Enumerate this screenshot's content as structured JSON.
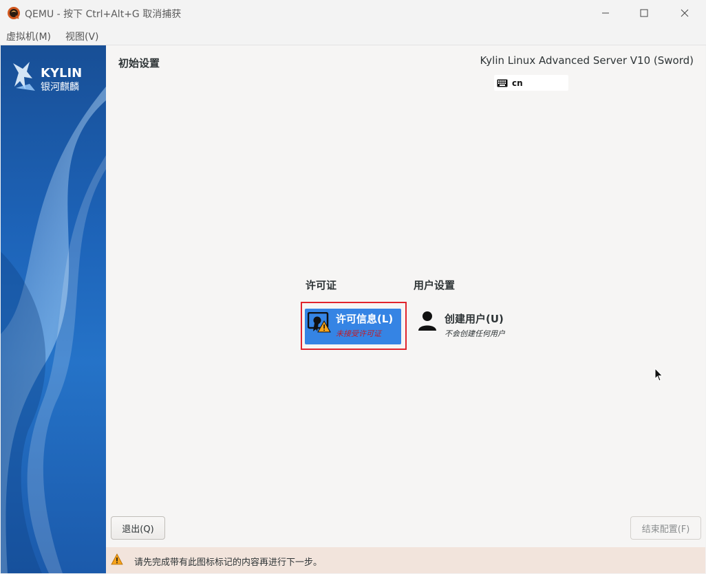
{
  "window": {
    "title": "QEMU - 按下 Ctrl+Alt+G 取消捕获",
    "app_icon": "qemu-logo-icon",
    "controls": [
      "minimize-icon",
      "maximize-icon",
      "close-icon"
    ]
  },
  "menubar": {
    "items": [
      "虚拟机(M)",
      "视图(V)"
    ]
  },
  "sidebar": {
    "logo_text": "KYLIN",
    "logo_subtext": "银河麒麟"
  },
  "header": {
    "title": "初始设置",
    "product": "Kylin Linux Advanced Server V10 (Sword)",
    "keyboard_layout": "cn",
    "keyboard_icon": "keyboard-icon"
  },
  "sections": {
    "license": {
      "label": "许可证",
      "spoke": {
        "title": "许可信息(L)",
        "status": "未接受许可证",
        "icon": "license-warning-icon"
      }
    },
    "user": {
      "label": "用户设置",
      "spoke": {
        "title": "创建用户(U)",
        "status": "不会创建任何用户",
        "icon": "user-icon"
      }
    }
  },
  "buttons": {
    "quit": "退出(Q)",
    "finish": "结束配置(F)"
  },
  "warning": {
    "icon": "warning-icon",
    "text": "请先完成带有此图标标记的内容再进行下一步。"
  },
  "colors": {
    "accent": "#3584e4",
    "highlight_border": "#e0232c",
    "warning_text": "#c01c28",
    "warning_bar": "#f2e4dc",
    "sidebar": "#1d63b8"
  }
}
